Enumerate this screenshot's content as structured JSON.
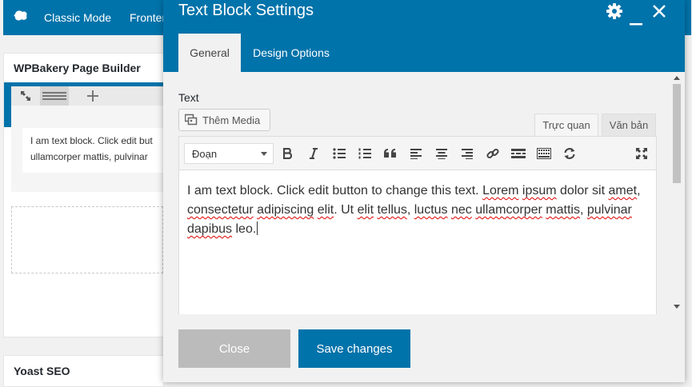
{
  "background": {
    "topbar": {
      "classic_mode": "Classic Mode",
      "frontend": "Frontend"
    },
    "panel": {
      "title": "WPBakery Page Builder",
      "text_element_lines": [
        "I am text block. Click edit but",
        "ullamcorper mattis, pulvinar"
      ]
    },
    "yoast": {
      "title": "Yoast SEO"
    }
  },
  "modal": {
    "title": "Text Block Settings",
    "tabs": [
      {
        "label": "General",
        "active": true
      },
      {
        "label": "Design Options",
        "active": false
      }
    ],
    "field_label": "Text",
    "add_media_label": "Thêm Media",
    "editor_tabs": {
      "visual": "Trực quan",
      "text": "Văn bản"
    },
    "format_select": "Đoạn",
    "toolbar_icons": [
      "bold-icon",
      "italic-icon",
      "bullet-list-icon",
      "numbered-list-icon",
      "blockquote-icon",
      "align-left-icon",
      "align-center-icon",
      "align-right-icon",
      "link-icon",
      "read-more-icon",
      "toolbar-toggle-icon",
      "refresh-icon",
      "fullscreen-icon"
    ],
    "content": {
      "plain_1": "I am text block. Click edit button to change this text. ",
      "spell_1": "Lorem",
      "plain_2": " ",
      "spell_2": "ipsum",
      "plain_3": " dolor sit ",
      "spell_3": "amet",
      "plain_4": ", ",
      "spell_4": "consectetur",
      "plain_5": " ",
      "spell_5": "adipiscing",
      "plain_6": " ",
      "spell_6": "elit",
      "plain_7": ". Ut ",
      "spell_7": "elit",
      "plain_8": " ",
      "spell_8": "tellus",
      "plain_9": ", ",
      "spell_9": "luctus",
      "plain_10": " ",
      "spell_10": "nec",
      "plain_11": " ",
      "spell_11": "ullamcorper",
      "plain_12": " ",
      "spell_12": "mattis",
      "plain_13": ", ",
      "spell_13": "pulvinar",
      "plain_14": " ",
      "spell_14": "dapibus",
      "plain_15": " leo."
    },
    "buttons": {
      "close": "Close",
      "save": "Save changes"
    }
  },
  "colors": {
    "brand_blue": "#0073aa",
    "close_gray": "#bbbbbb",
    "spell_red": "#dd0000"
  }
}
